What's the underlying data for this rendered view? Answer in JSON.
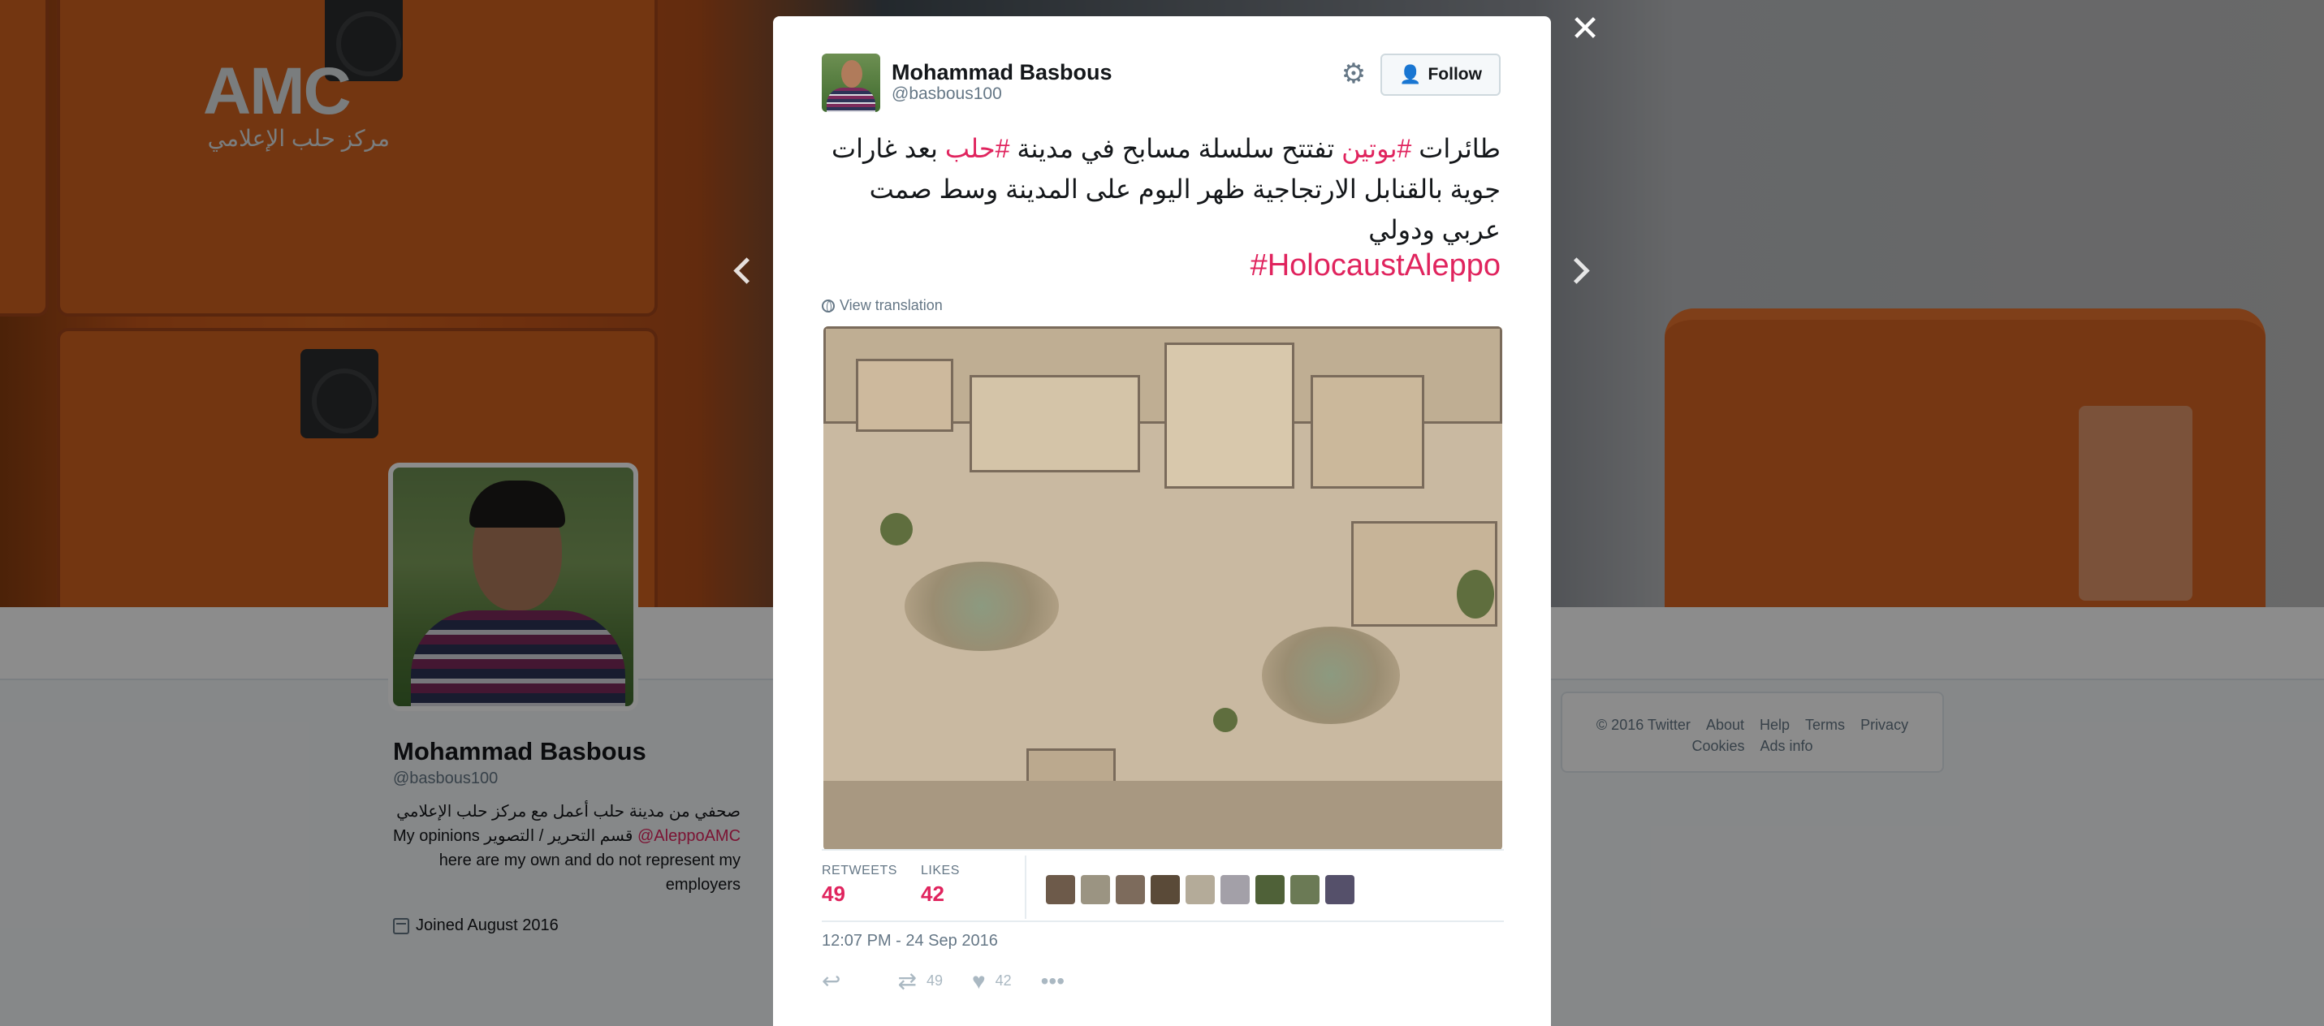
{
  "background_profile": {
    "banner_logo_text": "AMC",
    "banner_logo_arabic": "مركز حلب الإعلامي",
    "name": "Mohammad Basbous",
    "handle": "@basbous100",
    "bio_arabic": "صحفي من مدينة حلب أعمل مع مركز حلب الإعلامي",
    "bio_line2_prefix": "My opinions",
    "bio_line2_arabic": "قسم التحرير / التصوير",
    "bio_link": "@AleppoAMC",
    "bio_line3": "here are my own and do not represent my employers",
    "joined": "Joined August 2016"
  },
  "footer": {
    "copyright": "© 2016 Twitter",
    "links": [
      "About",
      "Help",
      "Terms",
      "Privacy",
      "Cookies",
      "Ads info"
    ]
  },
  "modal": {
    "close_label": "✕",
    "author_name": "Mohammad Basbous",
    "author_handle": "@basbous100",
    "follow_label": "Follow",
    "tweet": {
      "word_1": "طائرات",
      "hashtag_1": "#بوتين",
      "part_2": "تفتتح سلسلة مسابح في مدينة",
      "hashtag_2": "#حلب",
      "part_3": "بعد غارات جوية بالقنابل الارتجاجية ظهر اليوم على المدينة وسط صمت عربي ودولي",
      "hashtag_latin": "#HolocaustAleppo"
    },
    "view_translation_label": "View translation",
    "stats": {
      "retweets_label": "RETWEETS",
      "retweets_value": "49",
      "likes_label": "LIKES",
      "likes_value": "42"
    },
    "liker_colors": [
      "#6d5a4a",
      "#9b9482",
      "#7d6b5c",
      "#5a4a38",
      "#b4ab99",
      "#a3a0a8",
      "#4f6138",
      "#6b7a55",
      "#55506a"
    ],
    "timestamp": "12:07 PM - 24 Sep 2016",
    "actions": {
      "retweet_count": "49",
      "like_count": "42"
    }
  },
  "colors": {
    "accent": "#e0245e",
    "link_blue": "#1da1f2",
    "muted": "#657786"
  },
  "icons": [
    "close-icon",
    "chevron-left-icon",
    "chevron-right-icon",
    "gear-icon",
    "follow-person-icon",
    "globe-icon",
    "reply-icon",
    "retweet-icon",
    "heart-icon",
    "more-icon",
    "calendar-icon"
  ]
}
